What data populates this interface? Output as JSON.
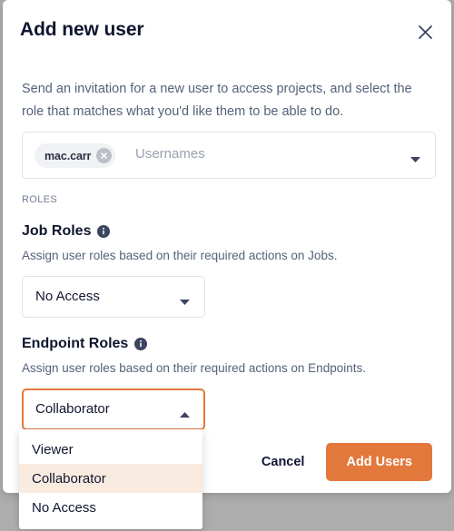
{
  "modal": {
    "title": "Add new user",
    "close_icon": "close-icon",
    "description": "Send an invitation for a new user to access projects, and select the role that matches what you'd like them to be able to do."
  },
  "usernames": {
    "placeholder": "Usernames",
    "chips": [
      {
        "label": "mac.carr",
        "remove_icon": "chip-remove-icon"
      }
    ],
    "caret_icon": "chevron-down-icon"
  },
  "roles_label": "ROLES",
  "job_roles": {
    "heading": "Job Roles",
    "info_icon": "info-icon",
    "description": "Assign user roles based on their required actions on Jobs.",
    "selected": "No Access",
    "caret_icon": "chevron-down-icon"
  },
  "endpoint_roles": {
    "heading": "Endpoint Roles",
    "info_icon": "info-icon",
    "description": "Assign user roles based on their required actions on Endpoints.",
    "selected": "Collaborator",
    "caret_icon": "chevron-up-icon",
    "open": true,
    "options": [
      {
        "label": "Viewer",
        "selected": false
      },
      {
        "label": "Collaborator",
        "selected": true
      },
      {
        "label": "No Access",
        "selected": false
      }
    ]
  },
  "footer": {
    "cancel_label": "Cancel",
    "submit_label": "Add Users"
  },
  "colors": {
    "accent": "#e2783c",
    "accent_soft": "#faebe0",
    "text_primary": "#10162f",
    "text_muted": "#55617c",
    "border": "#dfe2e8",
    "backdrop": "#adadad"
  }
}
